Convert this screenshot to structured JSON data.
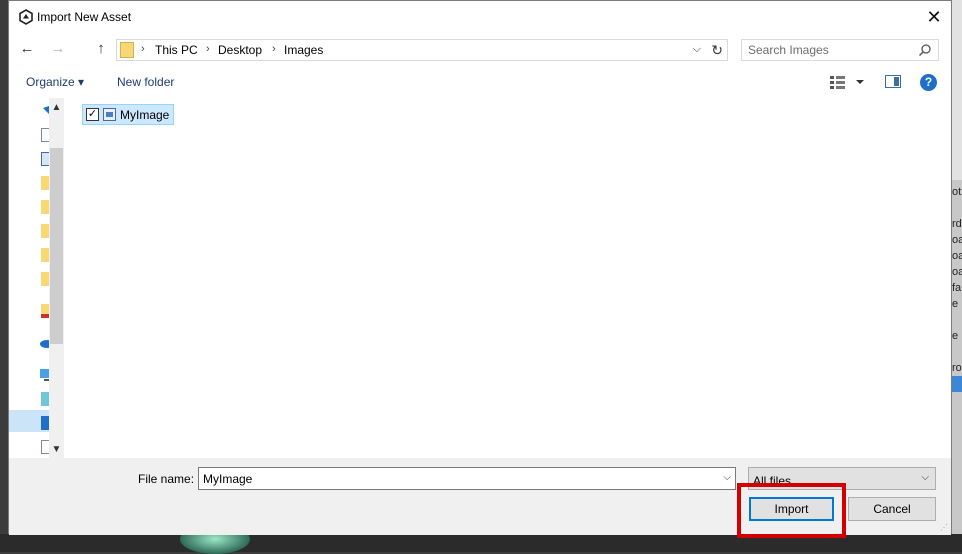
{
  "window": {
    "title": "Import New Asset",
    "close_symbol": "✕"
  },
  "nav": {
    "back_symbol": "←",
    "forward_symbol": "→",
    "up_symbol": "↑",
    "path": [
      "This PC",
      "Desktop",
      "Images"
    ],
    "search_placeholder": "Search Images"
  },
  "toolbar": {
    "organize_label": "Organize ▾",
    "new_folder_label": "New folder",
    "help_label": "?"
  },
  "files": [
    {
      "name": "MyImage",
      "checked": true
    }
  ],
  "bottom": {
    "file_name_label": "File name:",
    "file_name_value": "MyImage",
    "file_type_value": "All files",
    "import_label": "Import",
    "cancel_label": "Cancel"
  },
  "background": {
    "side_text": [
      "ot",
      "rd",
      "oa",
      "oa",
      "oa",
      "fa",
      "e P",
      "e",
      "ro"
    ]
  },
  "colors": {
    "accent": "#0078d7",
    "highlight_box": "#d40000",
    "selection": "#cce8ff"
  }
}
